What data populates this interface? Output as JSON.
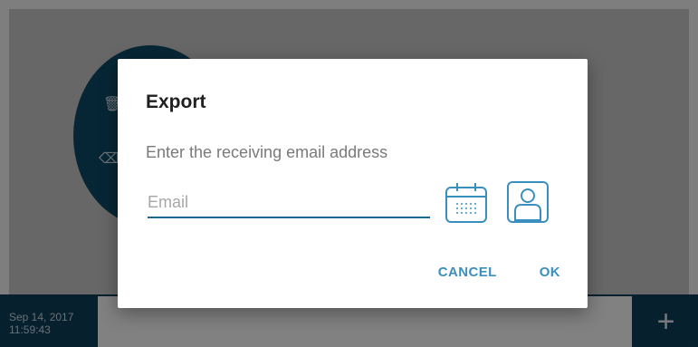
{
  "background": {
    "date": "Sep 14, 2017",
    "time": "11:59:43",
    "add_icon": "plus-icon",
    "circle_icons": [
      "trash-icon",
      "eraser-icon"
    ]
  },
  "dialog": {
    "title": "Export",
    "message": "Enter the receiving email address",
    "email_placeholder": "Email",
    "calendar_icon": "calendar-icon",
    "contact_icon": "contact-icon",
    "cancel_label": "CANCEL",
    "ok_label": "OK"
  },
  "colors": {
    "accent": "#3b8fbe",
    "input_underline": "#1b6693",
    "dark_navy": "#0e3f59"
  }
}
